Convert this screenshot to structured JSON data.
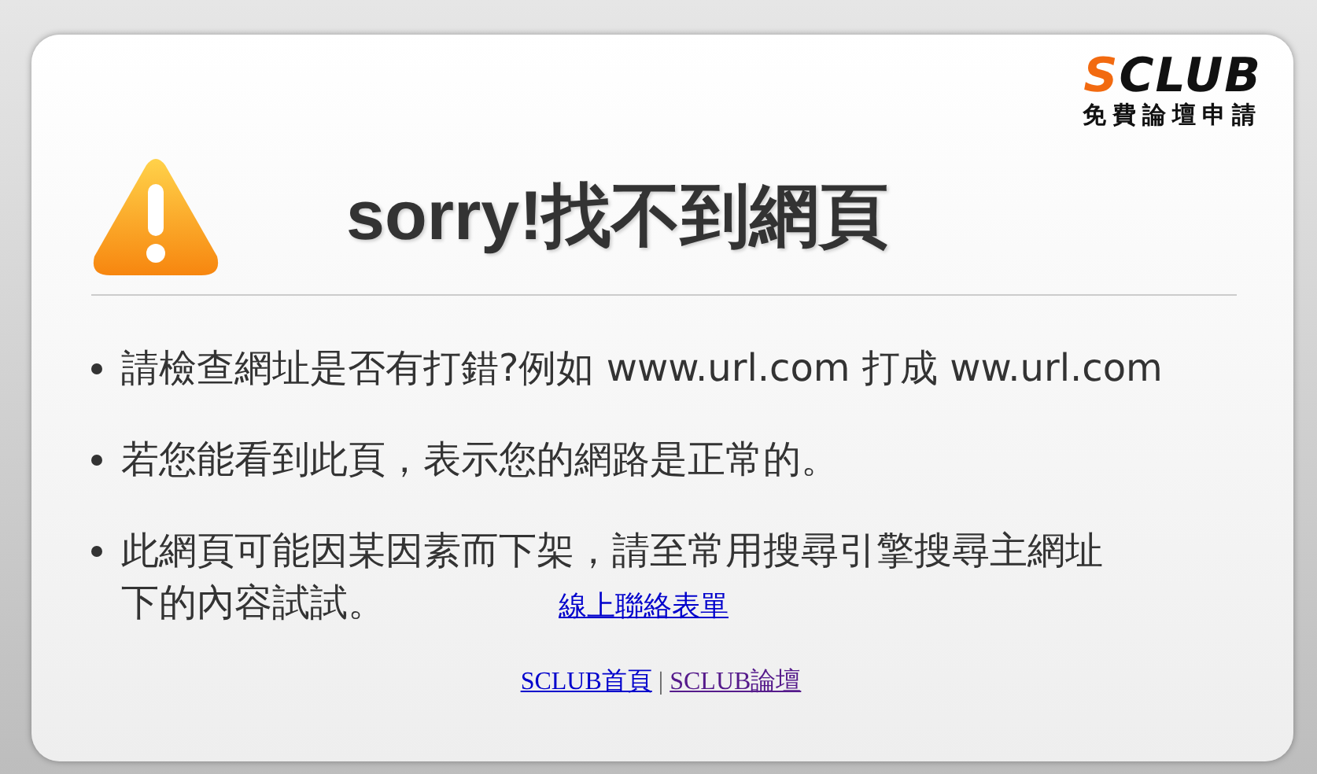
{
  "logo": {
    "brand_first": "S",
    "brand_rest": "CLUB",
    "tagline": "免費論壇申請"
  },
  "title": "sorry!找不到網頁",
  "bullets": [
    {
      "text": "請檢查網址是否有打錯?例如 www.url.com 打成 ww.url.com"
    },
    {
      "text": "若您能看到此頁，表示您的網路是正常的。"
    },
    {
      "text": "此網頁可能因某因素而下架，請至常用搜尋引擎搜尋主網址",
      "text_continued": "下的內容試試。",
      "link": "線上聯絡表單"
    }
  ],
  "footer_links": [
    {
      "label": "SCLUB首頁",
      "visited": false
    },
    {
      "label": "SCLUB論壇",
      "visited": true
    }
  ],
  "separator": "|"
}
